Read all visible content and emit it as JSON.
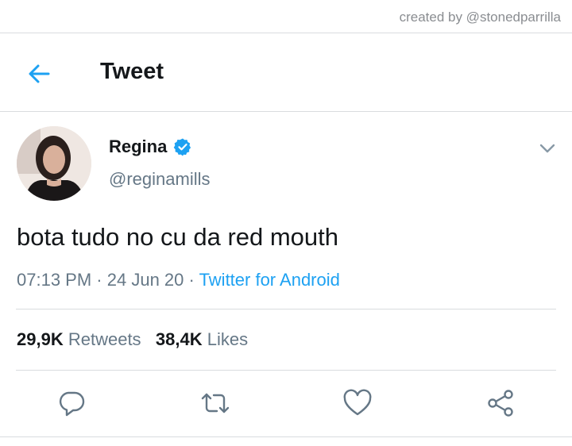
{
  "credit": "created by @stonedparrilla",
  "header": {
    "title": "Tweet",
    "back_icon": "arrow-left-icon"
  },
  "tweet": {
    "author_name": "Regina",
    "verified": true,
    "handle": "@reginamills",
    "text": "bota tudo no cu da red mouth",
    "time": "07:13 PM",
    "date": "24 Jun 20",
    "source": "Twitter for Android",
    "separator": "·"
  },
  "stats": {
    "retweets_count": "29,9K",
    "retweets_label": "Retweets",
    "likes_count": "38,4K",
    "likes_label": "Likes"
  },
  "actions": [
    "reply-icon",
    "retweet-icon",
    "like-icon",
    "share-icon"
  ],
  "colors": {
    "accent": "#1da1f2",
    "muted": "#657786",
    "text": "#14171a",
    "divider": "#d9dcdf"
  }
}
